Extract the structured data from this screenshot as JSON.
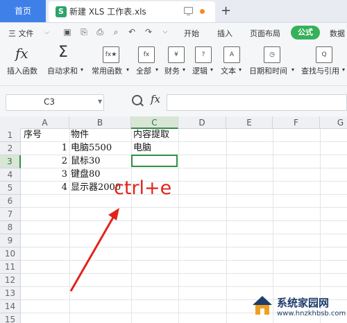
{
  "titlebar": {
    "home_tab": "首页",
    "doc_icon": "S",
    "doc_title": "新建 XLS 工作表.xls",
    "new_tab_icon": "+"
  },
  "menubar": {
    "file_menu": "三 文件",
    "items": [
      "开始",
      "插入",
      "页面布局",
      "公式",
      "数据"
    ],
    "active": "公式"
  },
  "ribbon": {
    "items": [
      {
        "label": "插入函数",
        "icon": "fx"
      },
      {
        "label": "自动求和",
        "icon": "Σ"
      },
      {
        "label": "常用函数",
        "icon": "fx★"
      },
      {
        "label": "全部",
        "icon": "fx"
      },
      {
        "label": "财务",
        "icon": "¥"
      },
      {
        "label": "逻辑",
        "icon": "?"
      },
      {
        "label": "文本",
        "icon": "A"
      },
      {
        "label": "日期和时间",
        "icon": "◷"
      },
      {
        "label": "查找与引用",
        "icon": "Q"
      }
    ]
  },
  "formula_bar": {
    "name_box": "C3",
    "fx": "fx",
    "formula": ""
  },
  "sheet": {
    "columns": [
      "A",
      "B",
      "C",
      "D",
      "E",
      "F",
      "G"
    ],
    "selected_column": "C",
    "rows": [
      "1",
      "2",
      "3",
      "4",
      "5",
      "6",
      "7",
      "8",
      "9",
      "10",
      "11",
      "12",
      "13",
      "14",
      "15"
    ],
    "selected_row": "3",
    "cells": {
      "A1": "序号",
      "B1": "物件",
      "C1": "内容提取",
      "A2": "1",
      "B2": "电脑5500",
      "C2": "电脑",
      "A3": "2",
      "B3": "鼠标30",
      "A4": "3",
      "B4": "键盘80",
      "A5": "4",
      "B5": "显示器2000"
    },
    "active_cell": "C3"
  },
  "annotation": "ctrl+e",
  "colors": {
    "accent_green": "#35b15a",
    "home_tab_blue": "#3f7fe8",
    "annotation_red": "#e2231a"
  },
  "watermark": {
    "text": "系统家园网",
    "url": "www.hnzkhbsb.com"
  }
}
